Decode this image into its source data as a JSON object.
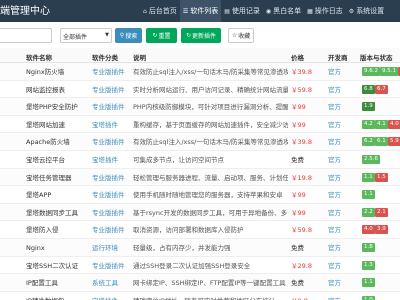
{
  "app": {
    "title": "端管理中心",
    "nav": [
      {
        "label": "后台首页",
        "icon": "home-icon",
        "glyph": "⌂",
        "active": false
      },
      {
        "label": "软件列表",
        "icon": "list-icon",
        "glyph": "☰",
        "active": true
      },
      {
        "label": "使用记录",
        "icon": "record-icon",
        "glyph": "▤",
        "active": false
      },
      {
        "label": "黑白名单",
        "icon": "shield-icon",
        "glyph": "◉",
        "active": false
      },
      {
        "label": "操作日志",
        "icon": "log-icon",
        "glyph": "▦",
        "active": false
      },
      {
        "label": "系统设置",
        "icon": "gear-icon",
        "glyph": "⚙",
        "active": false
      }
    ]
  },
  "toolbar": {
    "search_placeholder": "",
    "category_value": "全部插件",
    "search_label": "搜索",
    "reset_label": "重置",
    "update_label": "更新插件",
    "fav_label": "收藏"
  },
  "table": {
    "headers": {
      "name": "软件名称",
      "dev": "软件分类",
      "desc": "说明",
      "price": "价格",
      "devby": "开发商",
      "version": "版本与状态"
    },
    "rows": [
      {
        "name": "Nginx防火墙",
        "dev": "专业版插件",
        "desc": "有效防止sql注入/xss/一句话木马/防采集等常见渗透攻击",
        "price": "￥39.8",
        "devby": "官方",
        "versions": [
          {
            "t": "9.6.2",
            "c": "green"
          },
          {
            "t": "9.5.1",
            "c": "green"
          },
          {
            "t": "9.4",
            "c": "red"
          }
        ]
      },
      {
        "name": "网站监控报表",
        "dev": "专业版插件",
        "desc": "实时分析网站运行、用户访问记录、精确统计网站流量、IP、UV",
        "price": "￥59.8",
        "devby": "官方",
        "versions": [
          {
            "t": "6.8",
            "c": "dgreen"
          },
          {
            "t": "6.7",
            "c": "red"
          }
        ]
      },
      {
        "name": "堡塔PHP安全防护",
        "dev": "专业版插件",
        "desc": "PHP内核级防御模块，可针对项目进行漏洞分析、提醒权限...",
        "price": "￥99",
        "devby": "官方",
        "versions": [
          {
            "t": "1.9",
            "c": "dgreen"
          }
        ]
      },
      {
        "name": "堡塔网站加速",
        "dev": "宝塔插件",
        "desc": "重构缓存，基于页面缓存的网站加速插件，安全减少访问流",
        "price": "￥99",
        "devby": "官方",
        "versions": [
          {
            "t": "4.2",
            "c": "green"
          },
          {
            "t": "4.1",
            "c": "green"
          },
          {
            "t": "4.0",
            "c": "red"
          }
        ]
      },
      {
        "name": "Apache防火墙",
        "dev": "专业版插件",
        "desc": "有效防止sql注入/xss/一句话木马/防采集等常见渗透攻击",
        "price": "￥39.8",
        "devby": "官方",
        "versions": [
          {
            "t": "6.2",
            "c": "green"
          },
          {
            "t": "6.1",
            "c": "green"
          },
          {
            "t": "5.9",
            "c": "red"
          }
        ]
      },
      {
        "name": "宝塔云控平台",
        "dev": "宝塔插件",
        "desc": "可集成多节点，让访问空间节点",
        "price": "免费",
        "devby": "官方",
        "versions": [
          {
            "t": "2.5.6",
            "c": "green"
          }
        ]
      },
      {
        "name": "宝塔任务管理器",
        "dev": "专业版插件",
        "desc": "轻松管理与服务器进程、流量、启动项、服务、计划任务...",
        "price": "￥19.8",
        "devby": "官方",
        "versions": [
          {
            "t": "1.1",
            "c": "green"
          },
          {
            "t": "1.5",
            "c": "red"
          }
        ]
      },
      {
        "name": "堡塔APP",
        "dev": "专业版插件",
        "desc": "使用手机随时随地管理您的服务器，支持苹果和安卓",
        "price": "￥99",
        "devby": "官方",
        "versions": [
          {
            "t": "1.1",
            "c": "green"
          }
        ]
      },
      {
        "name": "堡塔数据同步工具",
        "dev": "专业版插件",
        "desc": "基于rsync开发的数据同步工具，可用于异地备份、多台主...",
        "price": "￥99",
        "devby": "官方",
        "versions": [
          {
            "t": "2.2",
            "c": "green"
          },
          {
            "t": "2.1",
            "c": "red"
          }
        ]
      },
      {
        "name": "堡塔防入侵",
        "dev": "专业版插件",
        "desc": "取消资源，访问部署和数据库入侵防护",
        "price": "￥59.8",
        "devby": "官方",
        "versions": [
          {
            "t": "4.0",
            "c": "red"
          },
          {
            "t": "3.9",
            "c": "red"
          }
        ]
      },
      {
        "name": "Nginx",
        "dev": "运行环境",
        "desc": "轻量级，占有内存少，并发能力强",
        "price": "免费",
        "devby": "官方",
        "versions": [
          {
            "t": "1.8",
            "c": "green"
          }
        ]
      },
      {
        "name": "宝塔SSH二次认证",
        "dev": "专业版插件",
        "desc": "通过SSH登录二次认证加强SSH登录安全",
        "price": "￥29.8",
        "devby": "官方",
        "versions": [
          {
            "t": "1.3",
            "c": "green"
          }
        ]
      },
      {
        "name": "IP配置工具",
        "dev": "系统工具",
        "desc": "网卡绑定IP、SSH绑定IP、FTP配置IP等一键配置工具",
        "price": "免费",
        "devby": "官方",
        "versions": [
          {
            "t": "1.1",
            "c": "green"
          }
        ]
      },
      {
        "name": "IP精准数据包",
        "dev": "宝塔插件",
        "desc": "精确定位IP地址，随着可实时推荐和地区分布统计",
        "price": "￥9.8",
        "devby": "官方",
        "versions": [
          {
            "t": "1.0",
            "c": "green"
          }
        ]
      }
    ]
  },
  "colors": {
    "topbar": "#2b3e50",
    "primary": "#3c8dbc",
    "success": "#00a65a",
    "price": "#e53935",
    "version_green": "#5cb85c",
    "version_red": "#d9534f"
  }
}
